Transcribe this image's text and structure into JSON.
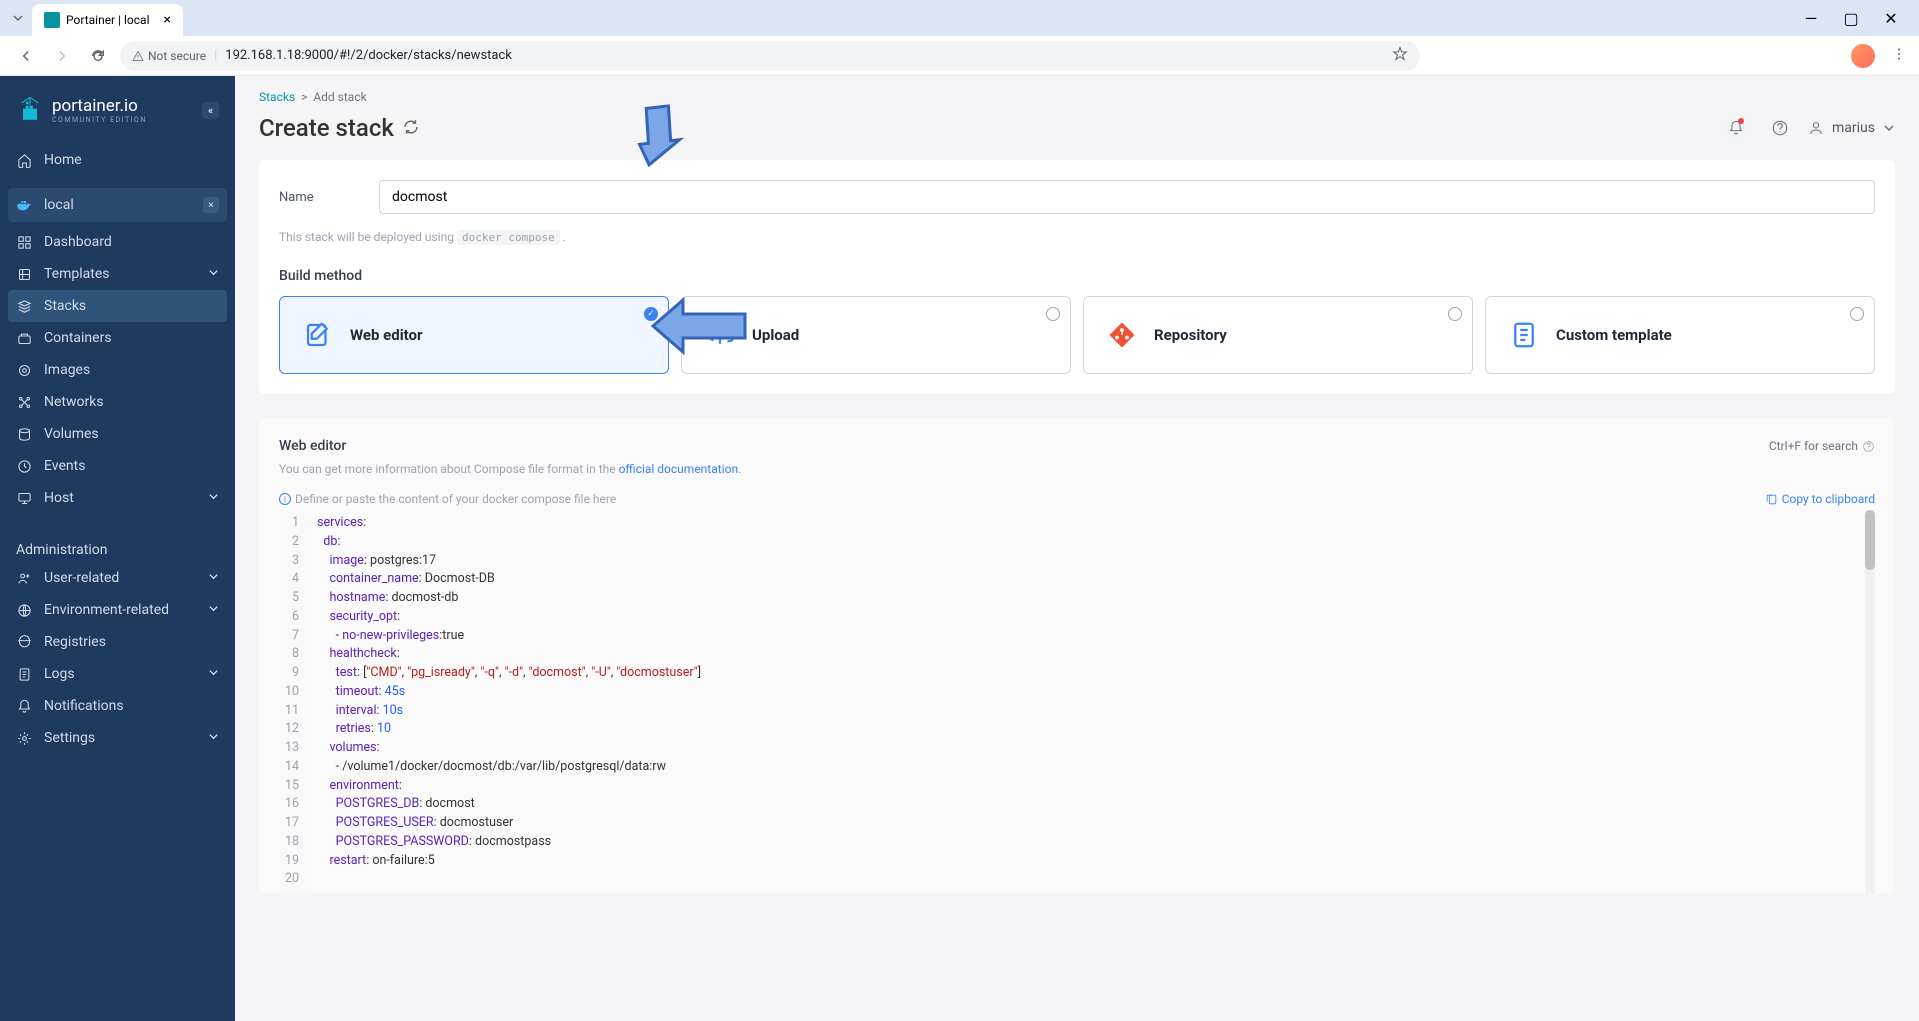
{
  "browser": {
    "tab_title": "Portainer | local",
    "security_label": "Not secure",
    "url": "192.168.1.18:9000/#!/2/docker/stacks/newstack"
  },
  "sidebar": {
    "logo": "portainer.io",
    "logo_sub": "COMMUNITY EDITION",
    "items": [
      {
        "icon": "home",
        "label": "Home"
      },
      {
        "icon": "docker",
        "label": "local",
        "active_env": true
      },
      {
        "icon": "dashboard",
        "label": "Dashboard"
      },
      {
        "icon": "templates",
        "label": "Templates",
        "chev": true
      },
      {
        "icon": "stacks",
        "label": "Stacks",
        "active": true
      },
      {
        "icon": "containers",
        "label": "Containers"
      },
      {
        "icon": "images",
        "label": "Images"
      },
      {
        "icon": "networks",
        "label": "Networks"
      },
      {
        "icon": "volumes",
        "label": "Volumes"
      },
      {
        "icon": "events",
        "label": "Events"
      },
      {
        "icon": "host",
        "label": "Host",
        "chev": true
      }
    ],
    "admin_label": "Administration",
    "admin_items": [
      {
        "icon": "user",
        "label": "User-related",
        "chev": true
      },
      {
        "icon": "env",
        "label": "Environment-related",
        "chev": true
      },
      {
        "icon": "registries",
        "label": "Registries"
      },
      {
        "icon": "logs",
        "label": "Logs",
        "chev": true
      },
      {
        "icon": "notify",
        "label": "Notifications"
      },
      {
        "icon": "settings",
        "label": "Settings",
        "chev": true
      }
    ]
  },
  "breadcrumb": {
    "root": "Stacks",
    "current": "Add stack"
  },
  "page": {
    "title": "Create stack",
    "username": "marius"
  },
  "form": {
    "name_label": "Name",
    "name_value": "docmost",
    "deploy_hint_pre": "This stack will be deployed using ",
    "deploy_hint_code": "docker compose",
    "deploy_hint_post": " .",
    "build_method_label": "Build method",
    "build_methods": [
      {
        "id": "web-editor",
        "label": "Web editor",
        "selected": true
      },
      {
        "id": "upload",
        "label": "Upload"
      },
      {
        "id": "repository",
        "label": "Repository"
      },
      {
        "id": "custom-template",
        "label": "Custom template"
      }
    ]
  },
  "editor": {
    "title": "Web editor",
    "search_hint": "Ctrl+F for search",
    "info_pre": "You can get more information about Compose file format in the ",
    "info_link": "official documentation",
    "define_hint": "Define or paste the content of your docker compose file here",
    "copy_label": "Copy to clipboard",
    "line_numbers": [
      "1",
      "2",
      "3",
      "4",
      "5",
      "6",
      "7",
      "8",
      "9",
      "10",
      "11",
      "12",
      "13",
      "14",
      "15",
      "16",
      "17",
      "18",
      "19",
      "20"
    ],
    "code_lines": [
      "services:",
      "  db:",
      "    image: postgres:17",
      "    container_name: Docmost-DB",
      "    hostname: docmost-db",
      "    security_opt:",
      "      - no-new-privileges:true",
      "    healthcheck:",
      "      test: [\"CMD\", \"pg_isready\", \"-q\", \"-d\", \"docmost\", \"-U\", \"docmostuser\"]",
      "      timeout: 45s",
      "      interval: 10s",
      "      retries: 10",
      "    volumes:",
      "      - /volume1/docker/docmost/db:/var/lib/postgresql/data:rw",
      "    environment:",
      "      POSTGRES_DB: docmost",
      "      POSTGRES_USER: docmostuser",
      "      POSTGRES_PASSWORD: docmostpass",
      "    restart: on-failure:5",
      ""
    ]
  }
}
